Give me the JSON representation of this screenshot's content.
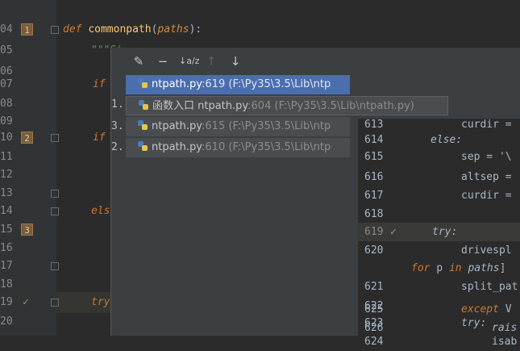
{
  "left_editor": {
    "lines": [
      {
        "num": "04",
        "bookmark": "1",
        "code": "def commonpath(paths):"
      },
      {
        "num": "05",
        "code": "\"\"\"Gi"
      },
      {
        "num": "06",
        "code": ""
      },
      {
        "num": "07",
        "code": "if"
      },
      {
        "num": "08",
        "code": ""
      },
      {
        "num": "09",
        "code": ""
      },
      {
        "num": "10",
        "bookmark": "2",
        "code": "if"
      },
      {
        "num": "11",
        "code": ""
      },
      {
        "num": "12",
        "code": ""
      },
      {
        "num": "13",
        "code": ""
      },
      {
        "num": "14",
        "code": "els"
      },
      {
        "num": "15",
        "bookmark": "3",
        "code": ""
      },
      {
        "num": "16",
        "code": ""
      },
      {
        "num": "17",
        "code": ""
      },
      {
        "num": "18",
        "code": ""
      },
      {
        "num": "19",
        "check": "✓",
        "code": "try"
      },
      {
        "num": "20",
        "code": ""
      }
    ]
  },
  "popup": {
    "toolbar": {
      "edit_icon": "✎",
      "remove_icon": "−",
      "sort_icon": "↓a/z",
      "up_icon": "↑",
      "down_icon": "↓"
    },
    "items": [
      {
        "key": "",
        "name": "ntpath.py",
        "line": ":619",
        "path": "(F:\\Py35\\3.5\\Lib\\ntp",
        "selected": true
      },
      {
        "key": "1.",
        "name": "函数入口 ntpath.py",
        "line": ":604",
        "path": "(F:\\Py35\\3.5\\Lib\\ntpath.py)",
        "hover": true
      },
      {
        "key": "3.",
        "name": "ntpath.py",
        "line": ":615",
        "path": "(F:\\Py35\\3.5\\Lib\\ntp"
      },
      {
        "key": "2.",
        "name": "ntpath.py",
        "line": ":610",
        "path": "(F:\\Py35\\3.5\\Lib\\ntp"
      }
    ],
    "preview": {
      "lines": [
        {
          "num": "613",
          "code": "curdir ="
        },
        {
          "num": "614",
          "code": "else:"
        },
        {
          "num": "615",
          "code": "sep = '\\"
        },
        {
          "num": "616",
          "code": "altsep ="
        },
        {
          "num": "617",
          "code": "curdir ="
        },
        {
          "num": "618",
          "code": ""
        },
        {
          "num": "619",
          "check": "✓",
          "code": "try:"
        },
        {
          "num": "620",
          "code": "drivespl"
        },
        {
          "num": "",
          "code": "for p in paths]"
        },
        {
          "num": "621",
          "code": "split_pat"
        },
        {
          "num": "622",
          "code": ""
        },
        {
          "num": "623",
          "code": "try:"
        },
        {
          "num": "624",
          "code": "isab"
        },
        {
          "num": "625",
          "code": "except V"
        },
        {
          "num": "626",
          "code": "rais"
        }
      ]
    }
  }
}
